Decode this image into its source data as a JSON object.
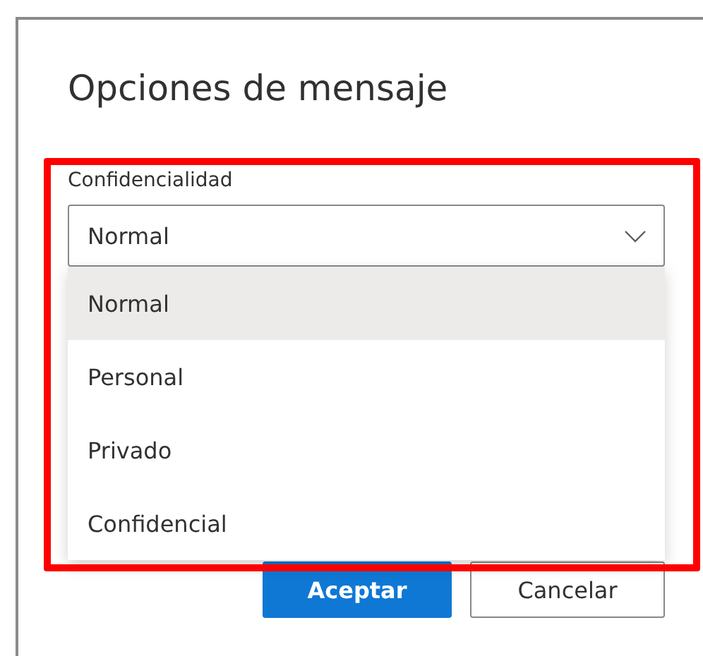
{
  "dialog": {
    "title": "Opciones de mensaje"
  },
  "field": {
    "label": "Confidencialidad",
    "value": "Normal",
    "expanded": true,
    "options": [
      {
        "label": "Normal",
        "selected": true
      },
      {
        "label": "Personal",
        "selected": false
      },
      {
        "label": "Privado",
        "selected": false
      },
      {
        "label": "Confidencial",
        "selected": false
      }
    ]
  },
  "buttons": [
    {
      "label": "Aceptar",
      "kind": "primary"
    },
    {
      "label": "Cancelar",
      "kind": "secondary"
    }
  ]
}
